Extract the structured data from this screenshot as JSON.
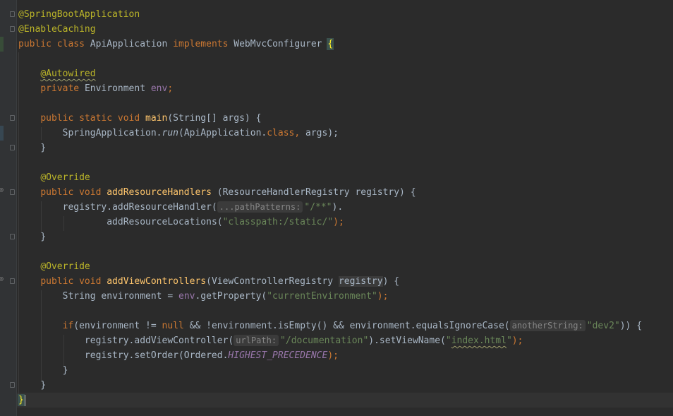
{
  "editor": {
    "theme_colors": {
      "background": "#2b2b2b",
      "keyword": "#cc7832",
      "annotation": "#bbb529",
      "string": "#6a8759",
      "method": "#ffc66d",
      "field": "#9876aa"
    },
    "lines": {
      "l1_ann": "@SpringBootApplication",
      "l2_ann": "@EnableCaching",
      "l3_kw1": "public",
      "l3_kw2": "class",
      "l3_name": "ApiApplication",
      "l3_kw3": "implements",
      "l3_iface": "WebMvcConfigurer",
      "l3_brace": "{",
      "l5_ann": "@Autowired",
      "l6_kw": "private",
      "l6_type": "Environment",
      "l6_field": "env",
      "l6_semi": ";",
      "l8_kw": "public static void",
      "l8_fn": "main",
      "l8_rest": "(String[] args) {",
      "l9_a": "SpringApplication.",
      "l9_run": "run",
      "l9_b": "(ApiApplication.",
      "l9_class": "class",
      "l9_comma": ",",
      "l9_c": " args);",
      "l10": "}",
      "l12_ann": "@Override",
      "l13_kw": "public void",
      "l13_fn": "addResourceHandlers",
      "l13_rest": " (ResourceHandlerRegistry registry) {",
      "l14_a": "registry.addResourceHandler(",
      "l14_hint": "...pathPatterns:",
      "l14_str": "\"/**\"",
      "l14_b": ").",
      "l15_a": "addResourceLocations(",
      "l15_str": "\"classpath:/static/\"",
      "l15_b": ");",
      "l16": "}",
      "l18_ann": "@Override",
      "l19_kw": "public void",
      "l19_fn": "addViewControllers",
      "l19_a": "(ViewControllerRegistry ",
      "l19_param": "registry",
      "l19_b": ") {",
      "l20_a": "String environment = ",
      "l20_field": "env",
      "l20_b": ".getProperty(",
      "l20_str": "\"currentEnvironment\"",
      "l20_c": ");",
      "l22_if": "if",
      "l22_a": "(environment != ",
      "l22_null": "null",
      "l22_b": " && !environment.isEmpty() && environment.equalsIgnoreCase(",
      "l22_hint": "anotherString:",
      "l22_str": "\"dev2\"",
      "l22_c": ")) {",
      "l23_a": "registry.addViewController(",
      "l23_hint": "urlPath:",
      "l23_str": "\"/documentation\"",
      "l23_b": ").setViewName(",
      "l23_str2_q1": "\"",
      "l23_str2": "index.html",
      "l23_str2_q2": "\"",
      "l23_c": ");",
      "l24_a": "registry.setOrder(Ordered.",
      "l24_const": "HIGHEST_PRECEDENCE",
      "l24_b": ");",
      "l25": "}",
      "l26": "}",
      "l27": "}"
    }
  }
}
